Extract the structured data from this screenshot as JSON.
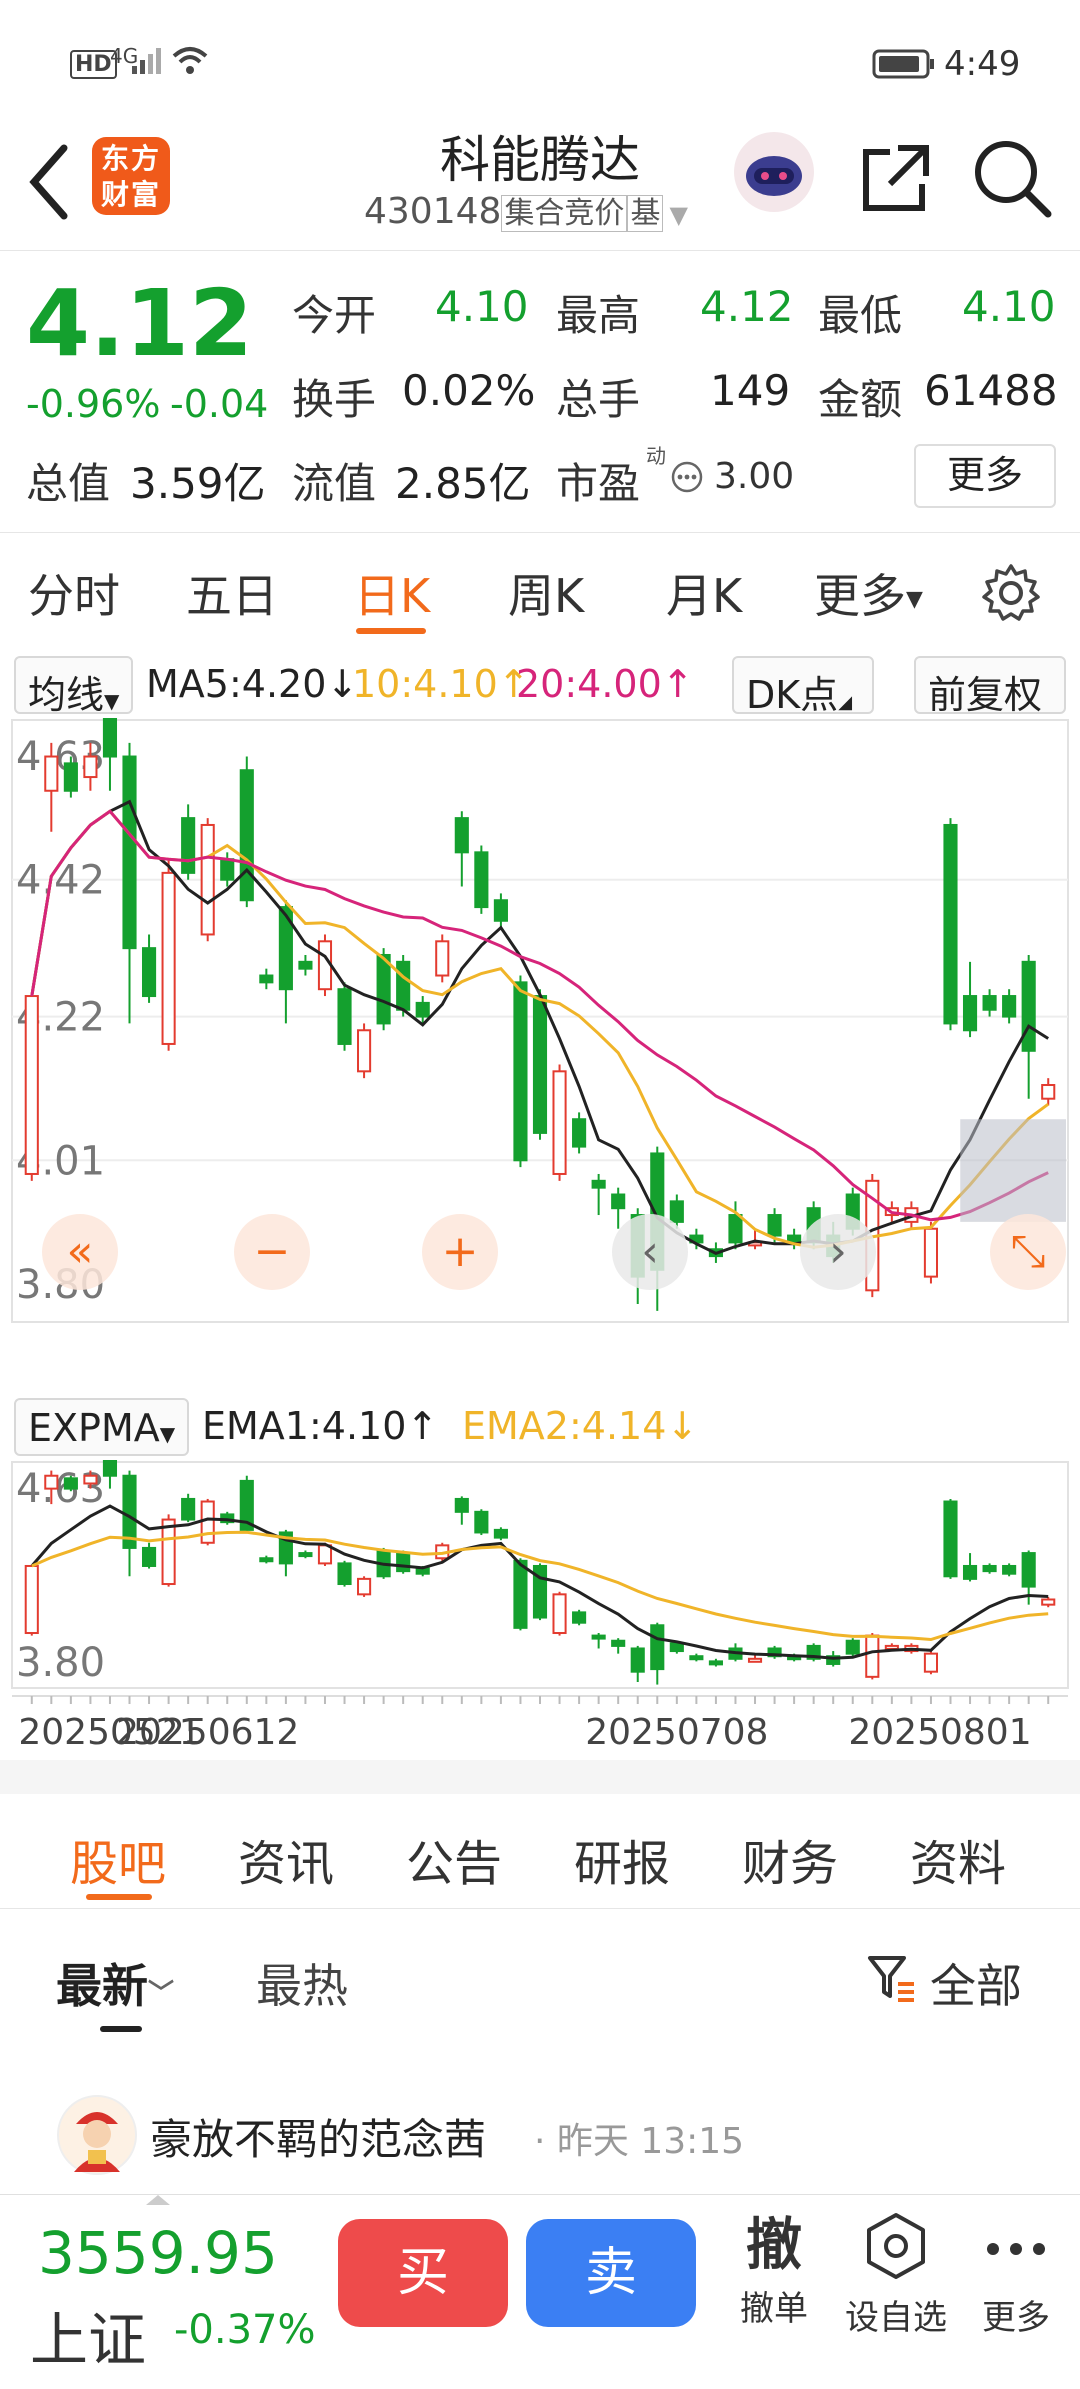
{
  "status": {
    "time": "4:49",
    "network": "4G",
    "hd": "HD"
  },
  "nav": {
    "back_icon": "chevron-left-icon",
    "logo_text": "东方财富",
    "stock_name": "科能腾达",
    "stock_code": "430148",
    "tag1": "集合竞价",
    "tag2": "基"
  },
  "quote": {
    "price": "4.12",
    "change_pct": "-0.96%",
    "change": "-0.04",
    "open_label": "今开",
    "open": "4.10",
    "high_label": "最高",
    "high": "4.12",
    "low_label": "最低",
    "low": "4.10",
    "turnover_label": "换手",
    "turnover": "0.02%",
    "volume_label": "总手",
    "volume": "149",
    "amount_label": "金额",
    "amount": "61488",
    "mktcap_label": "总值",
    "mktcap": "3.59亿",
    "float_label": "流值",
    "float_cap": "2.85亿",
    "pe_label": "市盈",
    "pe_sup": "动",
    "pe": "3.00",
    "more_button": "更多"
  },
  "period_tabs": [
    "分时",
    "五日",
    "日K",
    "周K",
    "月K",
    "更多"
  ],
  "active_period": "日K",
  "chart_toolbar": {
    "ma_select": "均线",
    "ma5": "MA5:4.20",
    "ma10": "10:4.10",
    "ma20": "20:4.00",
    "dk_button": "DK点",
    "adjust_button": "前复权",
    "ema_select": "EXPMA",
    "ema1": "EMA1:4.10",
    "ema2": "EMA2:4.14"
  },
  "colors": {
    "up": "#e33b2f",
    "down": "#14a02e",
    "ma5": "#222222",
    "ma10": "#f0b429",
    "ma20": "#d6247a",
    "accent": "#f26a1b"
  },
  "chart_data": {
    "type": "candlestick",
    "y_ticks_main": [
      "4.63",
      "4.42",
      "4.22",
      "4.01",
      "3.80"
    ],
    "y_ticks_ema": [
      "4.63",
      "3.80"
    ],
    "ylim": [
      3.8,
      4.63
    ],
    "x_labels": [
      "20250521",
      "20250612",
      "20250708",
      "20250801"
    ],
    "candles": [
      {
        "o": 3.99,
        "c": 4.25,
        "h": 4.25,
        "l": 3.98
      },
      {
        "o": 4.55,
        "c": 4.6,
        "h": 4.62,
        "l": 4.49
      },
      {
        "o": 4.59,
        "c": 4.55,
        "h": 4.6,
        "l": 4.54
      },
      {
        "o": 4.57,
        "c": 4.6,
        "h": 4.62,
        "l": 4.55
      },
      {
        "o": 4.66,
        "c": 4.6,
        "h": 4.7,
        "l": 4.55
      },
      {
        "o": 4.6,
        "c": 4.32,
        "h": 4.62,
        "l": 4.21
      },
      {
        "o": 4.32,
        "c": 4.25,
        "h": 4.34,
        "l": 4.24
      },
      {
        "o": 4.18,
        "c": 4.43,
        "h": 4.45,
        "l": 4.17
      },
      {
        "o": 4.51,
        "c": 4.43,
        "h": 4.53,
        "l": 4.42
      },
      {
        "o": 4.34,
        "c": 4.5,
        "h": 4.51,
        "l": 4.33
      },
      {
        "o": 4.45,
        "c": 4.42,
        "h": 4.46,
        "l": 4.41
      },
      {
        "o": 4.58,
        "c": 4.39,
        "h": 4.6,
        "l": 4.38
      },
      {
        "o": 4.28,
        "c": 4.27,
        "h": 4.29,
        "l": 4.26
      },
      {
        "o": 4.38,
        "c": 4.26,
        "h": 4.39,
        "l": 4.21
      },
      {
        "o": 4.3,
        "c": 4.29,
        "h": 4.31,
        "l": 4.28
      },
      {
        "o": 4.26,
        "c": 4.33,
        "h": 4.34,
        "l": 4.25
      },
      {
        "o": 4.26,
        "c": 4.18,
        "h": 4.27,
        "l": 4.17
      },
      {
        "o": 4.14,
        "c": 4.2,
        "h": 4.21,
        "l": 4.13
      },
      {
        "o": 4.31,
        "c": 4.21,
        "h": 4.32,
        "l": 4.2
      },
      {
        "o": 4.3,
        "c": 4.23,
        "h": 4.31,
        "l": 4.22
      },
      {
        "o": 4.24,
        "c": 4.22,
        "h": 4.25,
        "l": 4.21
      },
      {
        "o": 4.28,
        "c": 4.33,
        "h": 4.34,
        "l": 4.27
      },
      {
        "o": 4.51,
        "c": 4.46,
        "h": 4.52,
        "l": 4.41
      },
      {
        "o": 4.46,
        "c": 4.38,
        "h": 4.47,
        "l": 4.37
      },
      {
        "o": 4.39,
        "c": 4.36,
        "h": 4.4,
        "l": 4.35
      },
      {
        "o": 4.27,
        "c": 4.01,
        "h": 4.28,
        "l": 4.0
      },
      {
        "o": 4.25,
        "c": 4.05,
        "h": 4.26,
        "l": 4.04
      },
      {
        "o": 3.99,
        "c": 4.14,
        "h": 4.15,
        "l": 3.98
      },
      {
        "o": 4.07,
        "c": 4.03,
        "h": 4.08,
        "l": 4.02
      },
      {
        "o": 3.98,
        "c": 3.97,
        "h": 3.99,
        "l": 3.93
      },
      {
        "o": 3.96,
        "c": 3.94,
        "h": 3.97,
        "l": 3.91
      },
      {
        "o": 3.93,
        "c": 3.84,
        "h": 3.94,
        "l": 3.8
      },
      {
        "o": 4.02,
        "c": 3.85,
        "h": 4.03,
        "l": 3.79
      },
      {
        "o": 3.95,
        "c": 3.92,
        "h": 3.96,
        "l": 3.91
      },
      {
        "o": 3.9,
        "c": 3.89,
        "h": 3.91,
        "l": 3.88
      },
      {
        "o": 3.88,
        "c": 3.87,
        "h": 3.89,
        "l": 3.86
      },
      {
        "o": 3.93,
        "c": 3.89,
        "h": 3.95,
        "l": 3.88
      },
      {
        "o": 3.89,
        "c": 3.89,
        "h": 3.91,
        "l": 3.88
      },
      {
        "o": 3.93,
        "c": 3.9,
        "h": 3.94,
        "l": 3.89
      },
      {
        "o": 3.9,
        "c": 3.89,
        "h": 3.91,
        "l": 3.88
      },
      {
        "o": 3.94,
        "c": 3.89,
        "h": 3.95,
        "l": 3.88
      },
      {
        "o": 3.9,
        "c": 3.87,
        "h": 3.92,
        "l": 3.86
      },
      {
        "o": 3.96,
        "c": 3.91,
        "h": 3.97,
        "l": 3.9
      },
      {
        "o": 3.82,
        "c": 3.98,
        "h": 3.99,
        "l": 3.81
      },
      {
        "o": 3.93,
        "c": 3.94,
        "h": 3.95,
        "l": 3.92
      },
      {
        "o": 3.92,
        "c": 3.94,
        "h": 3.95,
        "l": 3.91
      },
      {
        "o": 3.84,
        "c": 3.91,
        "h": 3.92,
        "l": 3.83
      },
      {
        "o": 4.5,
        "c": 4.21,
        "h": 4.51,
        "l": 4.2
      },
      {
        "o": 4.25,
        "c": 4.2,
        "h": 4.3,
        "l": 4.19
      },
      {
        "o": 4.25,
        "c": 4.23,
        "h": 4.26,
        "l": 4.22
      },
      {
        "o": 4.25,
        "c": 4.22,
        "h": 4.26,
        "l": 4.21
      },
      {
        "o": 4.3,
        "c": 4.17,
        "h": 4.31,
        "l": 4.1
      },
      {
        "o": 4.1,
        "c": 4.12,
        "h": 4.13,
        "l": 4.09
      }
    ]
  },
  "feed_tabs": [
    "股吧",
    "资讯",
    "公告",
    "研报",
    "财务",
    "资料"
  ],
  "active_feed": "股吧",
  "sort_tabs": {
    "latest": "最新",
    "hot": "最热",
    "filter": "全部"
  },
  "post": {
    "author": "豪放不羁的范念茜",
    "time": "· 昨天 13:15"
  },
  "bottom_bar": {
    "index_value": "3559.95",
    "index_name": "上证",
    "index_change": "-0.37%",
    "buy": "买",
    "sell": "卖",
    "cancel_icon_text": "撤",
    "cancel": "撤单",
    "watch": "设自选",
    "more": "更多"
  }
}
